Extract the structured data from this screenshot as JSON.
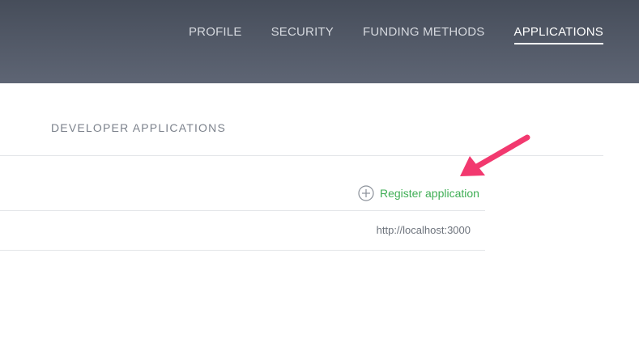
{
  "nav": {
    "tabs": [
      {
        "label": "PROFILE"
      },
      {
        "label": "SECURITY"
      },
      {
        "label": "FUNDING METHODS"
      },
      {
        "label": "APPLICATIONS"
      }
    ],
    "active_tab": "APPLICATIONS"
  },
  "section": {
    "title": "DEVELOPER APPLICATIONS",
    "register_label": "Register application",
    "register_icon": "plus-circle-icon"
  },
  "applications": [
    {
      "url": "http://localhost:3000"
    }
  ],
  "colors": {
    "header": "#565d6b",
    "accent_green": "#3fae55",
    "annotation_arrow": "#f2396f"
  }
}
